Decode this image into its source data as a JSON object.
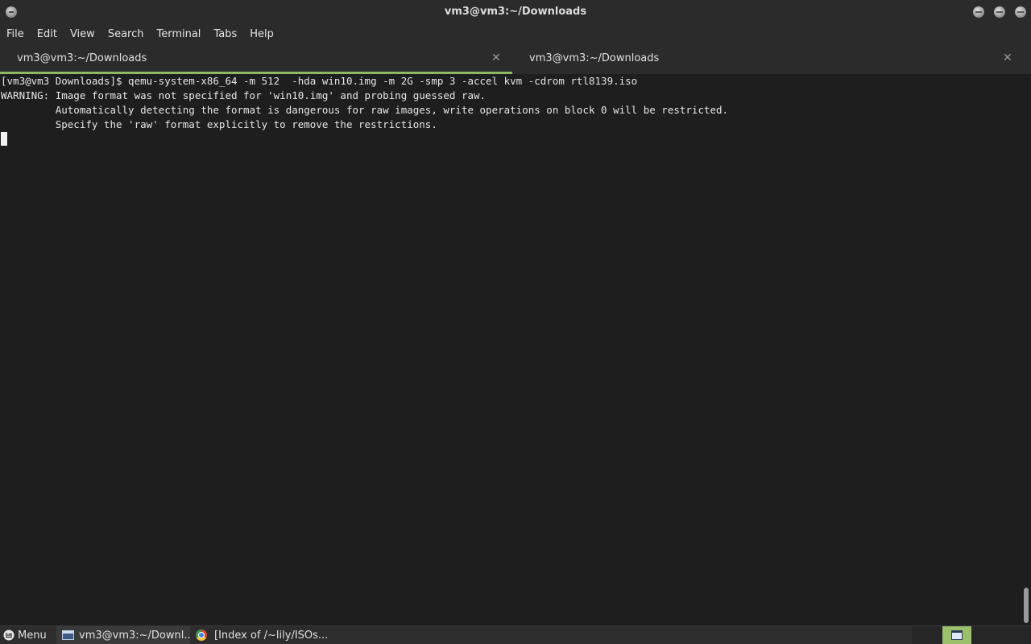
{
  "window": {
    "title": "vm3@vm3:~/Downloads"
  },
  "menubar": {
    "items": [
      {
        "label": "File"
      },
      {
        "label": "Edit"
      },
      {
        "label": "View"
      },
      {
        "label": "Search"
      },
      {
        "label": "Terminal"
      },
      {
        "label": "Tabs"
      },
      {
        "label": "Help"
      }
    ]
  },
  "tabs": [
    {
      "label": "vm3@vm3:~/Downloads",
      "close": "✕",
      "active": true
    },
    {
      "label": "vm3@vm3:~/Downloads",
      "close": "✕",
      "active": false
    }
  ],
  "terminal": {
    "lines": [
      "[vm3@vm3 Downloads]$ qemu-system-x86_64 -m 512  -hda win10.img -m 2G -smp 3 -accel kvm -cdrom rtl8139.iso",
      "WARNING: Image format was not specified for 'win10.img' and probing guessed raw.",
      "         Automatically detecting the format is dangerous for raw images, write operations on block 0 will be restricted.",
      "         Specify the 'raw' format explicitly to remove the restrictions."
    ]
  },
  "taskbar": {
    "menu_label": "Menu",
    "tasks": [
      {
        "label": "vm3@vm3:~/Downl...",
        "icon": "terminal-icon"
      },
      {
        "label": "[Index of /~lily/ISOs...",
        "icon": "chrome-icon"
      }
    ]
  },
  "colors": {
    "accent": "#8fb960",
    "terminal_bg": "#1e1e1e",
    "chrome_bg": "#2b2b2b"
  }
}
